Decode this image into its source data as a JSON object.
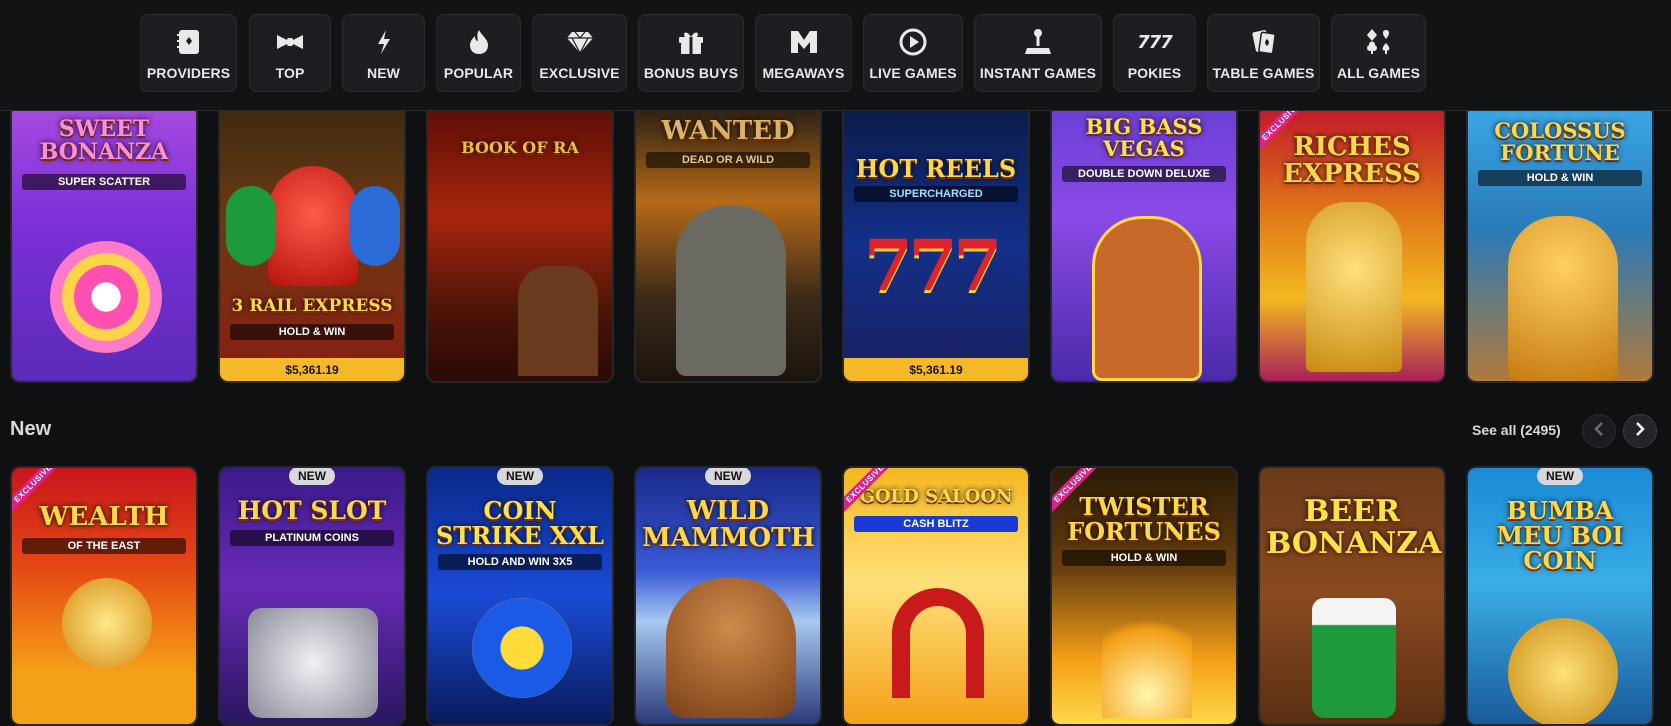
{
  "categories": [
    {
      "label": "PROVIDERS",
      "icon": "book-icon"
    },
    {
      "label": "TOP",
      "icon": "bowtie-icon"
    },
    {
      "label": "NEW",
      "icon": "lightning-icon"
    },
    {
      "label": "POPULAR",
      "icon": "fire-icon"
    },
    {
      "label": "EXCLUSIVE",
      "icon": "diamond-icon"
    },
    {
      "label": "BONUS BUYS",
      "icon": "gift-icon"
    },
    {
      "label": "MEGAWAYS",
      "icon": "megaways-icon"
    },
    {
      "label": "LIVE GAMES",
      "icon": "play-icon"
    },
    {
      "label": "INSTANT GAMES",
      "icon": "joystick-icon"
    },
    {
      "label": "POKIES",
      "icon": "777-icon"
    },
    {
      "label": "TABLE GAMES",
      "icon": "cards-icon"
    },
    {
      "label": "ALL GAMES",
      "icon": "suits-icon"
    }
  ],
  "top_row": [
    {
      "title": "SWEET BONANZA",
      "subtitle": "SUPER SCATTER",
      "jackpot": null
    },
    {
      "title": "3 RAIL EXPRESS",
      "subtitle": "HOLD & WIN",
      "jackpot": "$5,361.19"
    },
    {
      "title": "BOOK OF RA",
      "subtitle": "",
      "jackpot": null
    },
    {
      "title": "WANTED",
      "subtitle": "DEAD OR A WILD",
      "jackpot": null
    },
    {
      "title": "HOT REELS",
      "subtitle": "SUPERCHARGED",
      "jackpot": "$5,361.19"
    },
    {
      "title": "BIG BASS VEGAS",
      "subtitle": "DOUBLE DOWN DELUXE",
      "jackpot": null
    },
    {
      "title": "RICHES EXPRESS",
      "subtitle": "",
      "jackpot": null
    },
    {
      "title": "COLOSSUS FORTUNE",
      "subtitle": "HOLD & WIN",
      "jackpot": null
    }
  ],
  "new_section": {
    "title": "New",
    "see_all": "See all (2495)",
    "badge_new": "NEW",
    "badge_exclusive": "EXCLUSIVE"
  },
  "new_row": [
    {
      "title": "WEALTH",
      "subtitle": "OF THE EAST"
    },
    {
      "title": "HOT SLOT",
      "subtitle": "PLATINUM COINS"
    },
    {
      "title": "COIN STRIKE XXL",
      "subtitle": "HOLD AND WIN 3X5"
    },
    {
      "title": "WILD MAMMOTH",
      "subtitle": ""
    },
    {
      "title": "GOLD SALOON",
      "subtitle": "CASH BLITZ"
    },
    {
      "title": "TWISTER FORTUNES",
      "subtitle": "HOLD & WIN"
    },
    {
      "title": "BEER BONANZA",
      "subtitle": ""
    },
    {
      "title": "BUMBA MEU BOI COIN",
      "subtitle": ""
    }
  ],
  "colors": {
    "background": "#0f1012",
    "jackpot_bar": "#f5b828",
    "exclusive_ribbon": "#e0208a"
  }
}
